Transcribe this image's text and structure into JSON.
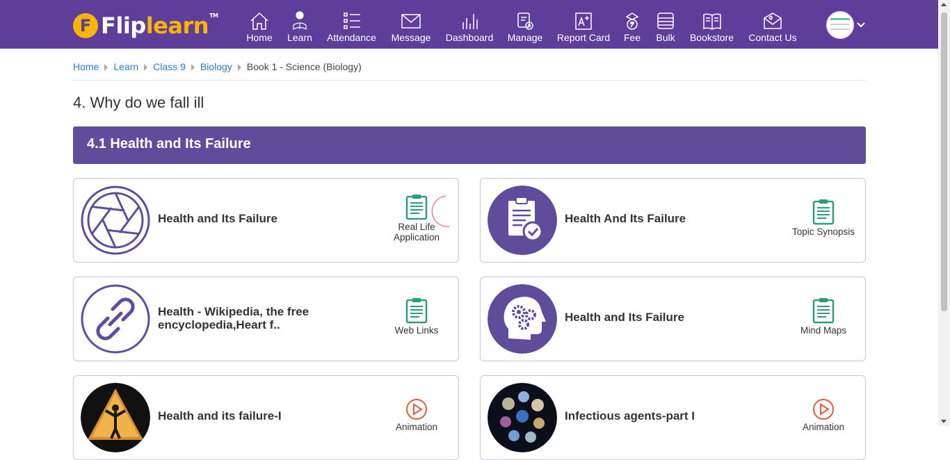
{
  "brand": {
    "flip": "Flip",
    "learn": "learn",
    "tm": "TM",
    "badge": "F"
  },
  "nav": [
    {
      "label": "Home",
      "icon": "home-icon"
    },
    {
      "label": "Learn",
      "icon": "learn-icon"
    },
    {
      "label": "Attendance",
      "icon": "attendance-icon"
    },
    {
      "label": "Message",
      "icon": "message-icon"
    },
    {
      "label": "Dashboard",
      "icon": "dashboard-icon"
    },
    {
      "label": "Manage",
      "icon": "manage-icon"
    },
    {
      "label": "Report Card",
      "icon": "report-card-icon"
    },
    {
      "label": "Fee",
      "icon": "fee-icon"
    },
    {
      "label": "Bulk",
      "icon": "bulk-icon"
    },
    {
      "label": "Bookstore",
      "icon": "bookstore-icon"
    },
    {
      "label": "Contact Us",
      "icon": "contact-icon"
    }
  ],
  "breadcrumb": {
    "links": [
      "Home",
      "Learn",
      "Class 9",
      "Biology"
    ],
    "current": "Book 1 - Science (Biology)"
  },
  "chapter_title": "4. Why do we fall ill",
  "section_title": "4.1 Health and Its Failure",
  "cards": [
    {
      "title": "Health and Its Failure",
      "type_label_1": "Real Life",
      "type_label_2": "Application",
      "thumb_icon": "aperture-icon",
      "type_icon": "clipboard-icon"
    },
    {
      "title": "Health And Its Failure",
      "type_label_1": "Topic Synopsis",
      "thumb_icon": "checklist-icon",
      "type_icon": "clipboard-icon"
    },
    {
      "title": "Health - Wikipedia, the free encyclopedia,Heart f..",
      "type_label_1": "Web Links",
      "thumb_icon": "link-icon",
      "type_icon": "clipboard-icon"
    },
    {
      "title": "Health and Its Failure",
      "type_label_1": "Mind Maps",
      "thumb_icon": "head-gears-icon",
      "type_icon": "clipboard-icon"
    },
    {
      "title": "Health and its failure-I",
      "type_label_1": "Animation",
      "thumb_icon": "pyramid-figure-image",
      "type_icon": "play-icon"
    },
    {
      "title": "Infectious agents-part I",
      "type_label_1": "Animation",
      "thumb_icon": "microbes-image",
      "type_icon": "play-icon"
    }
  ],
  "colors": {
    "navbar": "#5f3d9a",
    "brand_accent": "#f7b500",
    "section_bar": "#5f4c9b",
    "link": "#2a7bd1",
    "doc_icon": "#2e9b7a",
    "play_icon": "#e0593a"
  }
}
